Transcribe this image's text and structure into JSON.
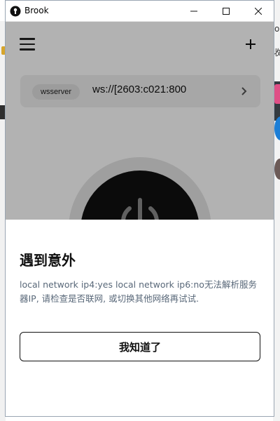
{
  "window": {
    "title": "Brook"
  },
  "background": {
    "fragment_1": "ok",
    "fragment_2": "收"
  },
  "toolbar": {
    "menu_icon": "hamburger-menu-icon",
    "add_icon": "plus-icon"
  },
  "server": {
    "tag": "wsserver",
    "address": "ws://[2603:c021:800"
  },
  "dialog": {
    "title": "遇到意外",
    "message": "local network ip4:yes local network ip6:no无法解析服务器IP, 请检查是否联网, 或切换其他网络再试试.",
    "confirm_label": "我知道了"
  },
  "colors": {
    "accent_dark": "#101010",
    "message_text": "#596879",
    "overlay": "rgba(0,0,0,0.30)"
  }
}
